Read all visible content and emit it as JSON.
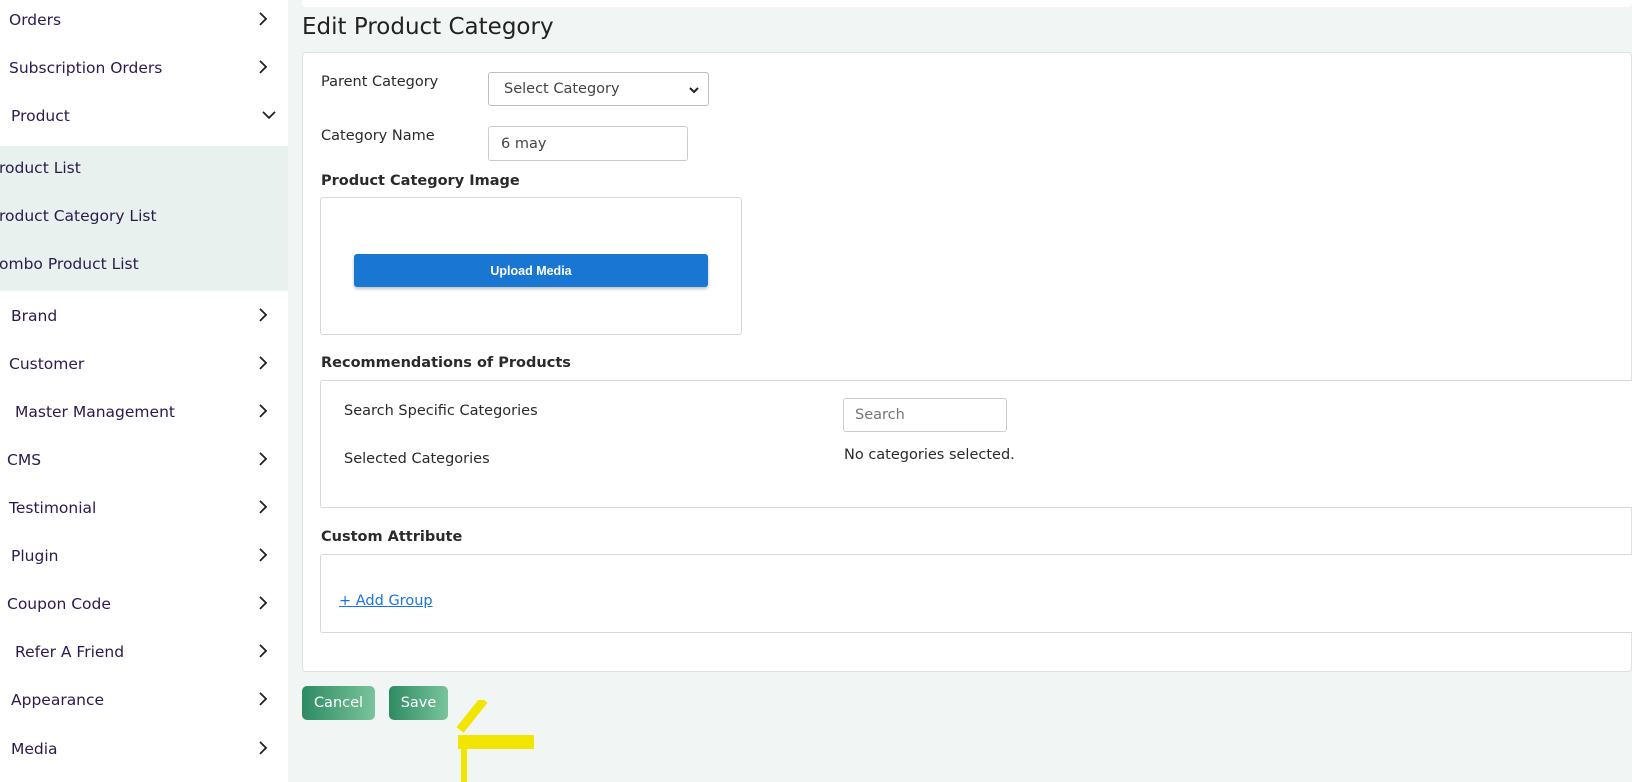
{
  "sidebar": {
    "items_top": [
      {
        "label": "Orders",
        "icon": "chevron-right-icon"
      },
      {
        "label": "Subscription Orders",
        "icon": "chevron-right-icon"
      },
      {
        "label": "Product",
        "icon": "chevron-down-icon"
      }
    ],
    "sub_items": [
      {
        "label": "roduct List"
      },
      {
        "label": "roduct Category List"
      },
      {
        "label": "ombo Product List"
      }
    ],
    "items_bottom": [
      {
        "label": "Brand",
        "icon": "chevron-right-icon"
      },
      {
        "label": "Customer",
        "icon": "chevron-right-icon"
      },
      {
        "label": "Master Management",
        "icon": "chevron-right-icon"
      },
      {
        "label": "CMS",
        "icon": "chevron-right-icon"
      },
      {
        "label": "Testimonial",
        "icon": "chevron-right-icon"
      },
      {
        "label": "Plugin",
        "icon": "chevron-right-icon"
      },
      {
        "label": "Coupon Code",
        "icon": "chevron-right-icon"
      },
      {
        "label": "Refer A Friend",
        "icon": "chevron-right-icon"
      },
      {
        "label": "Appearance",
        "icon": "chevron-right-icon"
      },
      {
        "label": "Media",
        "icon": "chevron-right-icon"
      }
    ]
  },
  "page": {
    "title": "Edit Product Category"
  },
  "form": {
    "parent_category_label": "Parent Category",
    "parent_category_value": "Select Category",
    "category_name_label": "Category Name",
    "category_name_value": "6 may",
    "image_section_label": "Product Category Image",
    "upload_button_label": "Upload Media",
    "recommendations_label": "Recommendations of Products",
    "search_categories_label": "Search Specific Categories",
    "search_placeholder": "Search",
    "selected_categories_label": "Selected Categories",
    "no_categories_text": "No categories selected.",
    "custom_attribute_label": "Custom Attribute",
    "add_group_link": "+ Add Group"
  },
  "actions": {
    "cancel_label": "Cancel",
    "save_label": "Save"
  },
  "colors": {
    "accent_blue": "#1976d2",
    "button_green_start": "#2e8b62",
    "button_green_end": "#79c49c",
    "sidebar_text": "#2b1a4d",
    "submenu_bg": "#e8f1ee",
    "annotation_yellow": "#f2e600"
  }
}
